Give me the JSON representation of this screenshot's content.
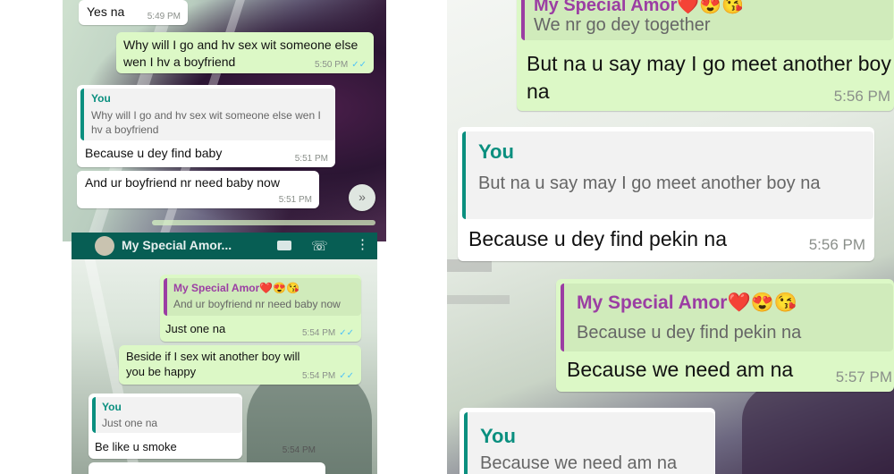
{
  "panel_a": {
    "messages": [
      {
        "text": "Yes na",
        "time": "5:49 PM"
      },
      {
        "text": "Why will I go and hv sex wit someone else wen I hv a boyfriend",
        "time": "5:50 PM",
        "ticks": "✓✓"
      },
      {
        "quote_name": "You",
        "quote_text": "Why will I go and hv sex wit someone else wen I hv a boyfriend",
        "text": "Because u dey find baby",
        "time": "5:51 PM"
      },
      {
        "text": "And ur boyfriend nr need baby now",
        "time": "5:51 PM"
      }
    ],
    "scroll_icon": "double-chevron-down"
  },
  "panel_b": {
    "header_title": "My Special Amor...",
    "messages": [
      {
        "quote_name": "My Special Amor❤️😍😘",
        "quote_text": "And ur boyfriend nr need baby now",
        "text": "Just one na",
        "time": "5:54 PM",
        "ticks": "✓✓"
      },
      {
        "text": "Beside if I sex wit another boy will you be happy",
        "time": "5:54 PM",
        "ticks": "✓✓"
      },
      {
        "quote_name": "You",
        "quote_text": "Just one na",
        "text": "Be like u smoke",
        "time": "5:54 PM"
      }
    ]
  },
  "panel_c": {
    "messages": [
      {
        "quote_name": "My Special Amor❤️😍😘",
        "quote_text": "We nr go dey together",
        "text": "But na u say may I go meet another boy na",
        "time": "5:56 PM"
      },
      {
        "quote_name": "You",
        "quote_text": "But na u say may I go meet another boy na",
        "text": "Because u dey find pekin na",
        "time": "5:56 PM"
      },
      {
        "quote_name": "My Special Amor❤️😍😘",
        "quote_text": "Because u dey find pekin na",
        "text": "Because we need am na",
        "time": "5:57 PM"
      },
      {
        "quote_name": "You",
        "quote_text": "Because we need am na"
      }
    ]
  }
}
